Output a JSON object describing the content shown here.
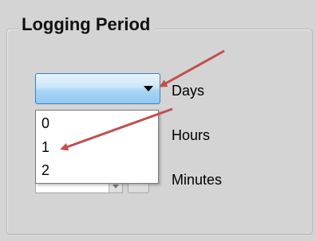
{
  "group": {
    "title": "Logging Period"
  },
  "interval_dropdown": {
    "selected_value": "",
    "options": [
      "0",
      "1",
      "2"
    ]
  },
  "units": {
    "days": "Days",
    "hours": "Hours",
    "minutes": "Minutes"
  },
  "colors": {
    "panel_background": "#d4d4d4",
    "combo_highlight": "#a9d6f6",
    "combo_border": "#3d7fb9",
    "annotation_arrow": "#c0504d"
  },
  "annotations": [
    {
      "icon": "arrow-icon",
      "points_to": "dropdown arrow"
    },
    {
      "icon": "arrow-icon",
      "points_to": "option 1"
    }
  ]
}
